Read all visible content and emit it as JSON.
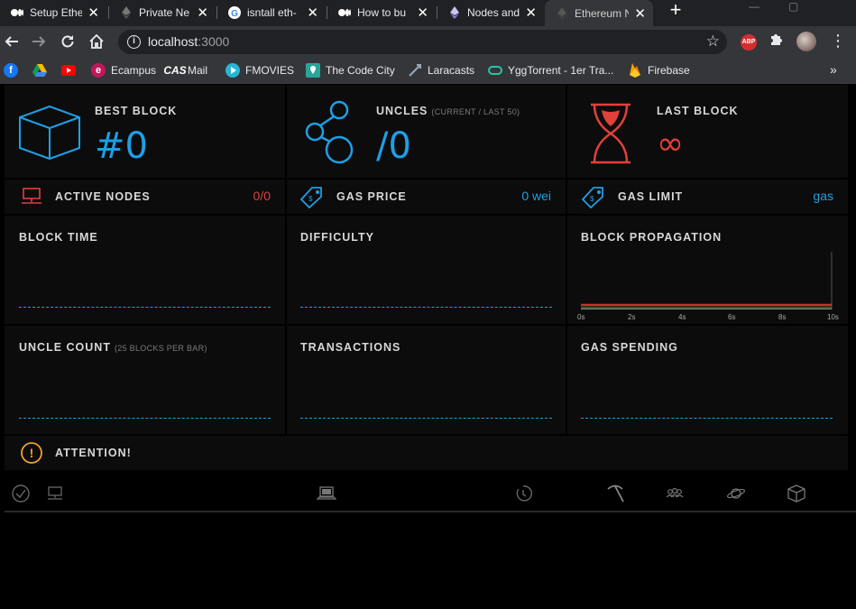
{
  "browser": {
    "tabs": [
      {
        "title": "Setup Ethe",
        "icon": "medium-icon"
      },
      {
        "title": "Private Ne",
        "icon": "ethereum-dark-icon"
      },
      {
        "title": "isntall eth-",
        "icon": "google-icon"
      },
      {
        "title": "How to bu",
        "icon": "medium-icon"
      },
      {
        "title": "Nodes and",
        "icon": "ethereum-icon"
      },
      {
        "title": "Ethereum N",
        "icon": "ethereum-dark-icon",
        "active": true
      }
    ],
    "url_host": "localhost",
    "url_port": ":3000",
    "bookmarks": [
      {
        "label": "",
        "icon": "facebook-icon"
      },
      {
        "label": "",
        "icon": "google-drive-icon"
      },
      {
        "label": "",
        "icon": "youtube-icon"
      },
      {
        "label": "Ecampus",
        "icon": "ecampus-icon"
      },
      {
        "label": "Mail",
        "icon": "cas-icon"
      },
      {
        "label": "FMOVIES",
        "icon": "play-icon"
      },
      {
        "label": "The Code City",
        "icon": "codecity-icon"
      },
      {
        "label": "Laracasts",
        "icon": "laracasts-icon"
      },
      {
        "label": "YggTorrent - 1er Tra...",
        "icon": "ygg-icon"
      },
      {
        "label": "Firebase",
        "icon": "firebase-icon"
      }
    ],
    "abp_label": "ABP"
  },
  "stats": {
    "best_block": {
      "label": "BEST BLOCK",
      "value": "#0"
    },
    "uncles": {
      "label": "UNCLES",
      "sublabel": "(CURRENT / LAST 50)",
      "value": "/0"
    },
    "last_block": {
      "label": "LAST BLOCK",
      "value": "∞"
    },
    "active_nodes": {
      "label": "ACTIVE NODES",
      "value": "0/0"
    },
    "gas_price": {
      "label": "GAS PRICE",
      "value": "0 wei"
    },
    "gas_limit": {
      "label": "GAS LIMIT",
      "value": "gas"
    }
  },
  "charts": {
    "block_time": {
      "label": "BLOCK TIME"
    },
    "difficulty": {
      "label": "DIFFICULTY"
    },
    "block_propagation": {
      "label": "BLOCK PROPAGATION",
      "ticks": [
        "0s",
        "2s",
        "4s",
        "6s",
        "8s",
        "10s"
      ]
    },
    "uncle_count": {
      "label": "UNCLE COUNT",
      "sublabel": "(25 BLOCKS PER BAR)"
    },
    "transactions": {
      "label": "TRANSACTIONS"
    },
    "gas_spending": {
      "label": "GAS SPENDING"
    }
  },
  "attention": {
    "label": "ATTENTION!"
  },
  "colors": {
    "accent_blue": "#1e9fe6",
    "accent_red": "#e2403a",
    "accent_orange": "#f0a030",
    "panel_bg": "#0c0c0c"
  }
}
